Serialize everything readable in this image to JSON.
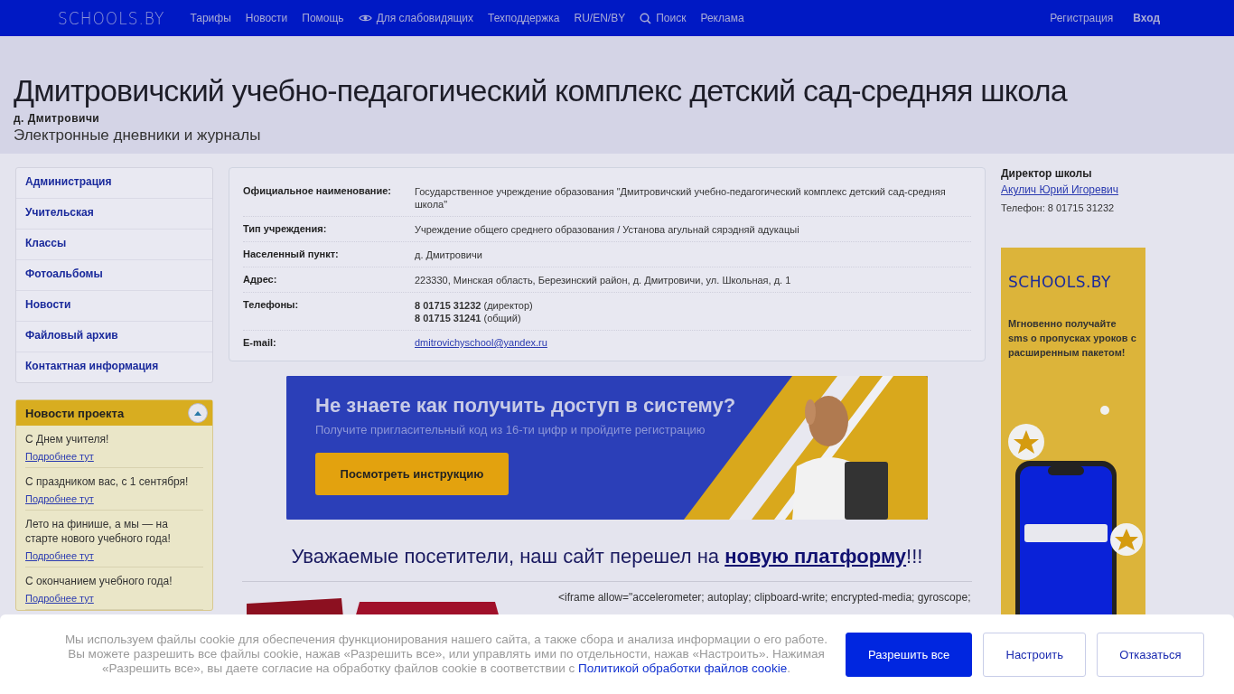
{
  "topbar": {
    "logo": "SCHOOLS.BY",
    "nav": [
      {
        "label": "Тарифы",
        "kind": "plain"
      },
      {
        "label": "Новости",
        "kind": "plain"
      },
      {
        "label": "Помощь",
        "kind": "plain"
      },
      {
        "label": "Для слабовидящих",
        "kind": "eye"
      },
      {
        "label": "Техподдержка",
        "kind": "plain"
      },
      {
        "label": "RU/EN/BY",
        "kind": "plain"
      },
      {
        "label": "Поиск",
        "kind": "search"
      },
      {
        "label": "Реклама",
        "kind": "plain"
      }
    ],
    "auth": [
      {
        "label": "Регистрация",
        "bold": false
      },
      {
        "label": "Вход",
        "bold": true
      }
    ]
  },
  "header": {
    "title": "Дмитровичский учебно-педагогический комплекс детский сад-средняя школа",
    "place": "д. Дмитровичи",
    "subtitle": "Электронные дневники и журналы"
  },
  "sidebar": {
    "menu": [
      "Администрация",
      "Учительская",
      "Классы",
      "Фотоальбомы",
      "Новости",
      "Файловый архив",
      "Контактная информация"
    ],
    "news": {
      "title": "Новости проекта",
      "expanded": true,
      "items": [
        {
          "text": "С Днем учителя!",
          "link": "Подробнее тут"
        },
        {
          "text": "С праздником вас, с 1 сентября!",
          "link": "Подробнее тут"
        },
        {
          "text": "Лето на финише, а мы — на старте нового учебного года!",
          "link": "Подробнее тут"
        },
        {
          "text": "С окончанием учебного года!",
          "link": "Подробнее тут"
        }
      ]
    }
  },
  "info": {
    "rows": [
      {
        "label": "Официальное наименование:",
        "kind": "text",
        "value": "Государственное учреждение образования \"Дмитровичский учебно-педагогический комплекс детский сад-средняя школа\""
      },
      {
        "label": "Тип учреждения:",
        "kind": "text",
        "value": "Учреждение общего среднего образования / Установа агульнай сярэдняй адукацыі"
      },
      {
        "label": "Населенный пункт:",
        "kind": "text",
        "value": "д. Дмитровичи"
      },
      {
        "label": "Адрес:",
        "kind": "text",
        "value": "223330, Минская область, Березинский район, д. Дмитровичи, ул. Школьная, д. 1"
      },
      {
        "label": "Телефоны:",
        "kind": "lines",
        "lines": [
          "**8 01715 31232** (директор)",
          "**8 01715 31241** (общий)"
        ]
      },
      {
        "label": "E-mail:",
        "kind": "link",
        "value": "dmitrovichyschool@yandex.ru"
      }
    ]
  },
  "banner": {
    "title": "Не знаете как получить доступ в систему?",
    "subtitle": "Получите пригласительный код из 16-ти цифр и пройдите регистрацию",
    "button": "Посмотреть инструкцию"
  },
  "notice": {
    "text": "Уважаемые посетители, наш сайт перешел на ",
    "link": "новую платформу",
    "tail": "!!!"
  },
  "embed": {
    "code": "<iframe allow=\"accelerometer; autoplay; clipboard-write; encrypted-media; gyroscope;"
  },
  "director": {
    "title": "Директор школы",
    "name": "Акулич Юрий Игоревич",
    "phone": "Телефон: 8 01715 31232"
  },
  "ad": {
    "logo": "SCHOOLS.BY",
    "text": "Мгновенно получайте sms о пропусках уроков с расширенным пакетом!"
  },
  "cookie": {
    "text": "Мы используем файлы cookie для обеспечения функционирования нашего сайта, а также сбора и анализа информации о его работе. Вы можете разрешить все файлы cookie, нажав «Разрешить все», или управлять ими по отдельности, нажав «Настроить». Нажимая «Разрешить все», вы даете согласие на обработку файлов cookie в соответствии с ",
    "link": "Политикой обработки файлов cookie",
    "tail": ".",
    "buttons": [
      {
        "label": "Разрешить все",
        "primary": true
      },
      {
        "label": "Настроить",
        "primary": false
      },
      {
        "label": "Отказаться",
        "primary": false
      }
    ]
  }
}
